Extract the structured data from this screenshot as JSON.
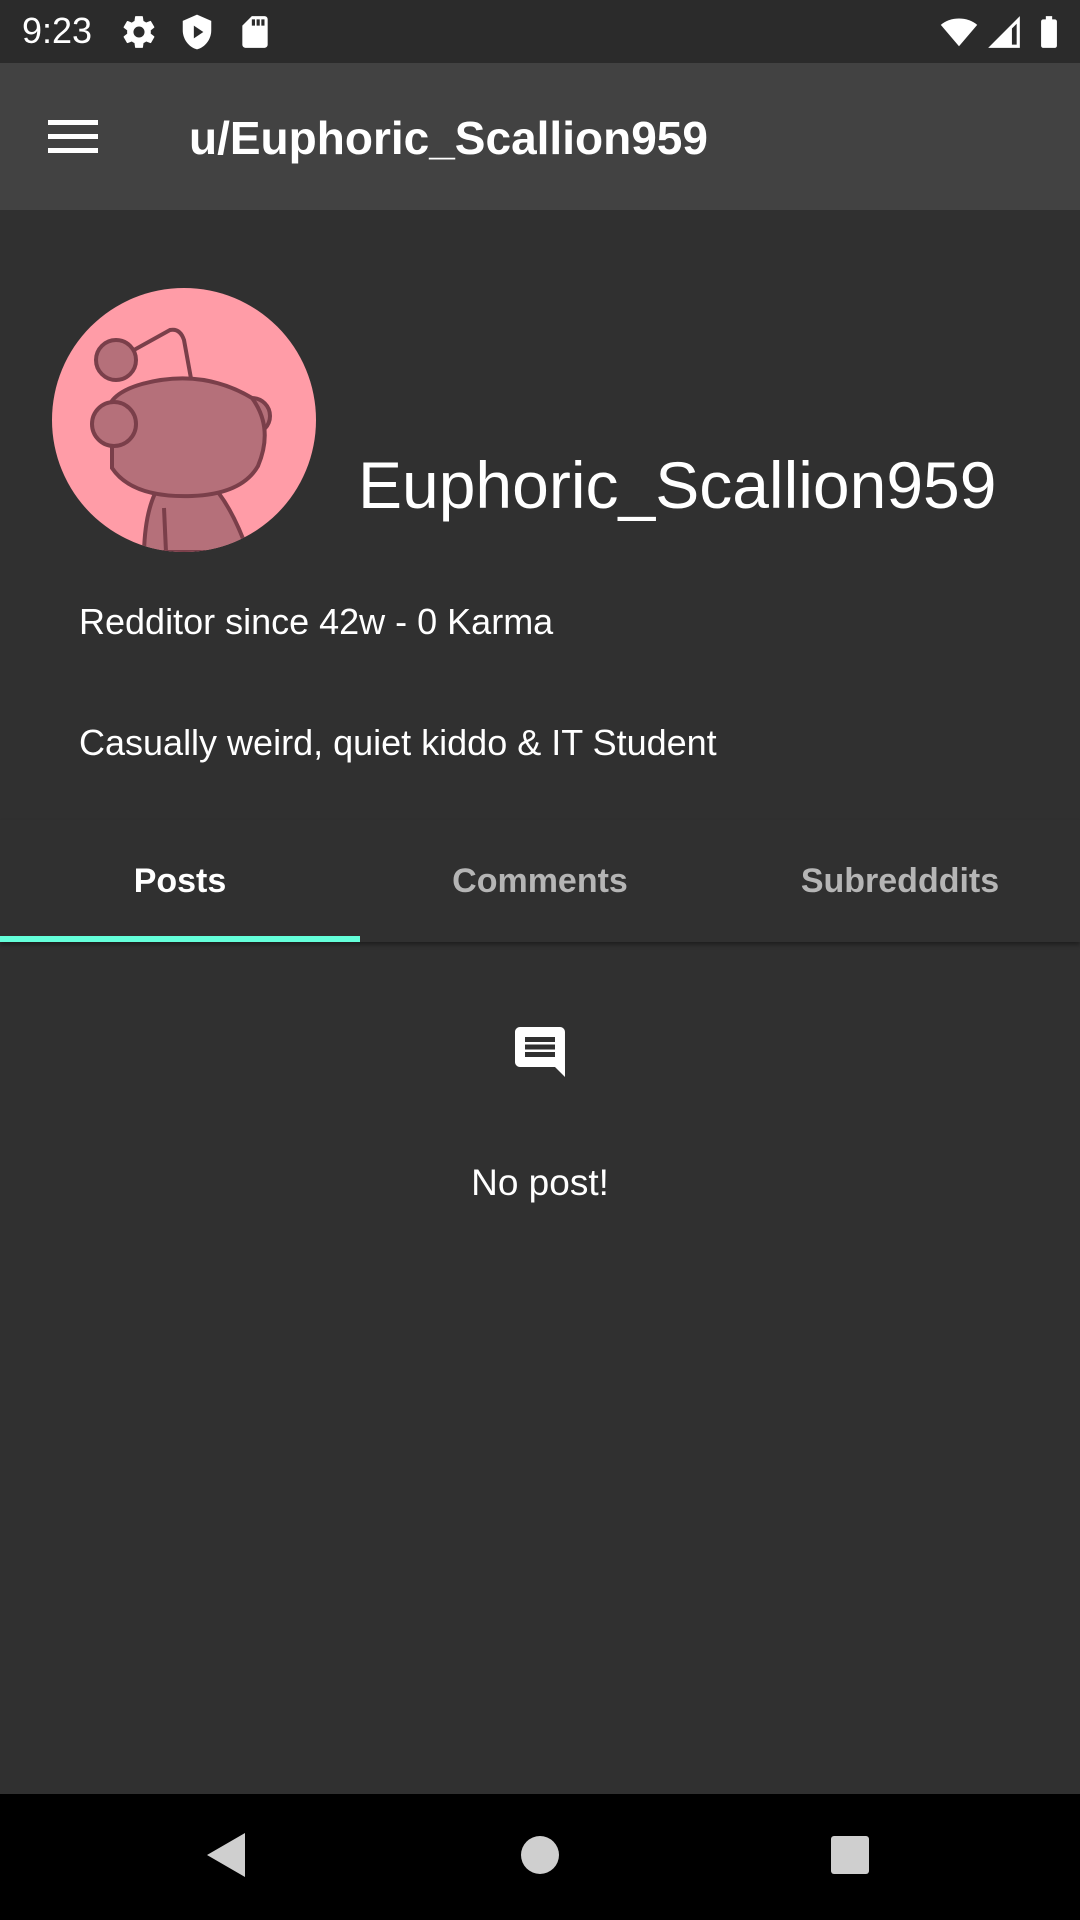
{
  "status_bar": {
    "time": "9:23",
    "icons": [
      "gear-icon",
      "shield-icon",
      "sd-card-icon",
      "wifi-icon",
      "signal-icon",
      "battery-icon"
    ]
  },
  "toolbar": {
    "menu_icon": "menu-icon",
    "title": "u/Euphoric_Scallion959",
    "background": "#424242"
  },
  "profile": {
    "avatar_icon": "snoo-avatar-icon",
    "avatar_color": "#ff9ca7",
    "username": "Euphoric_Scallion959",
    "meta": "Redditor since 42w - 0 Karma",
    "bio": "Casually weird, quiet kiddo & IT Student"
  },
  "tabs": {
    "items": [
      {
        "label": "Posts",
        "active": true
      },
      {
        "label": "Comments",
        "active": false
      },
      {
        "label": "Subredddits",
        "active": false
      }
    ],
    "indicator_color": "#64ffda"
  },
  "content": {
    "empty_icon": "comment-icon",
    "empty_text": "No post!"
  },
  "nav_bar": {
    "buttons": [
      "back-icon",
      "home-icon",
      "recents-icon"
    ]
  }
}
